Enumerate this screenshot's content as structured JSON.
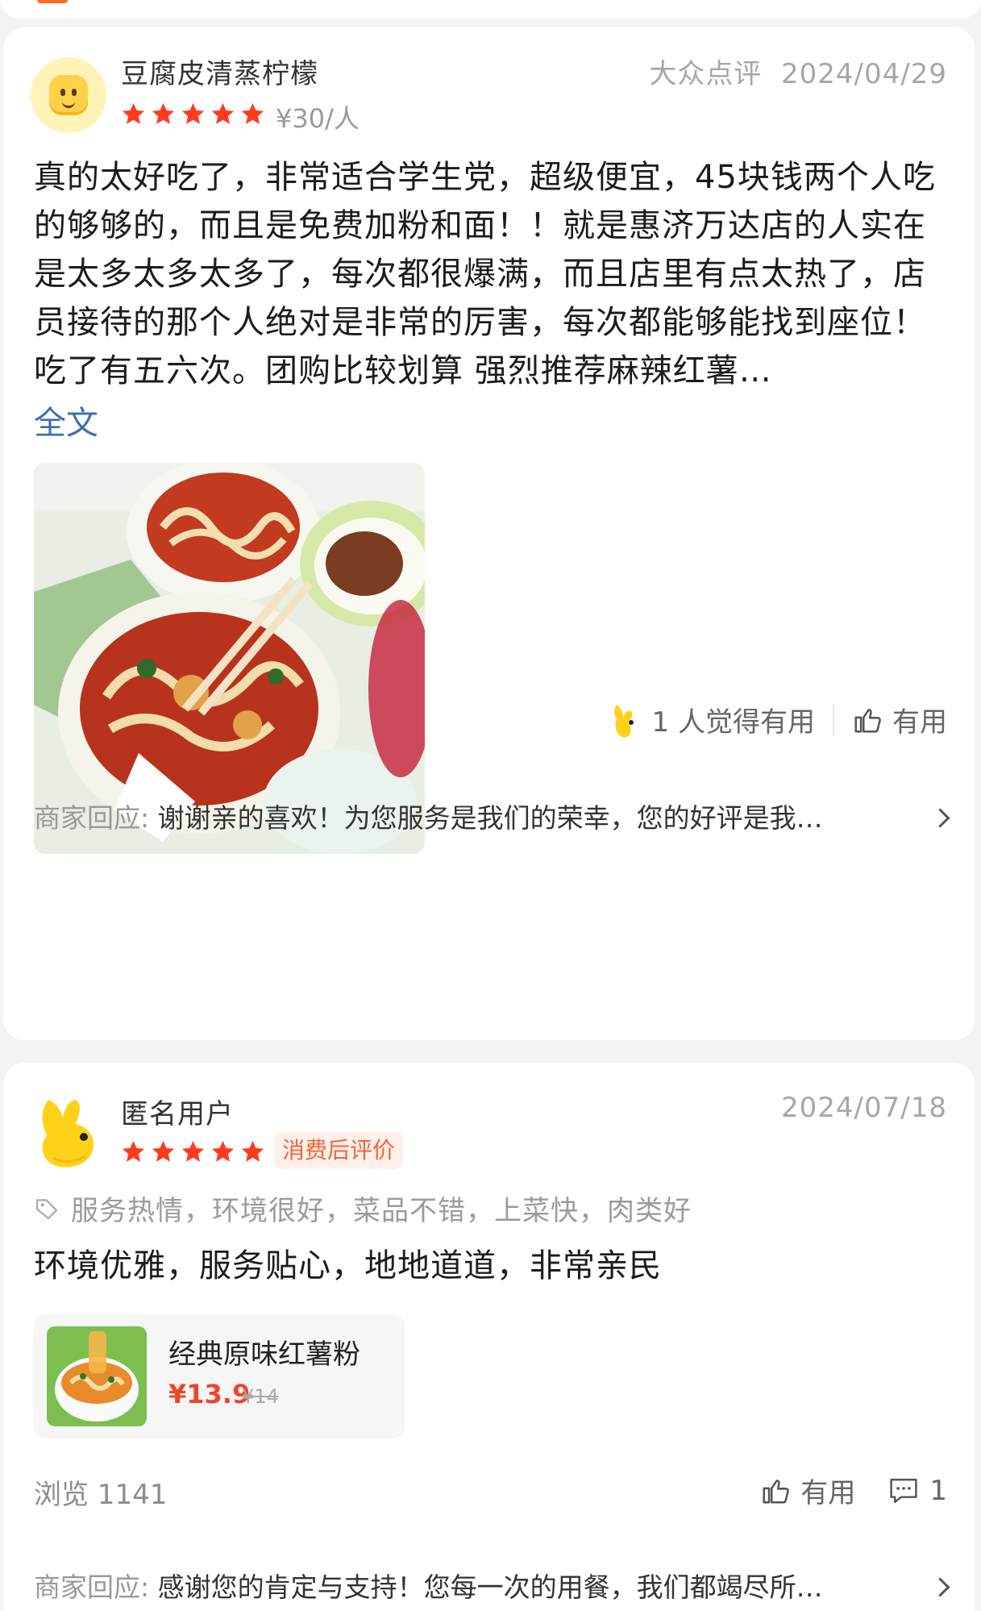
{
  "review1": {
    "username": "豆腐皮清蒸柠檬",
    "source": "大众点评",
    "date": "2024/04/29",
    "rating": 5,
    "price": "¥30/人",
    "text": "真的太好吃了，非常适合学生党，超级便宜，45块钱两个人吃的够够的，而且是免费加粉和面！！就是惠济万达店的人实在是太多太多太多了，每次都很爆满，而且店里有点太热了，店员接待的那个人绝对是非常的厉害，每次都能够能找到座位！吃了有五六次。团购比较划算 强烈推荐麻辣红薯…",
    "fulltext_label": "全文",
    "helpful_count_text": "1 人觉得有用",
    "helpful_button": "有用",
    "merchant_label": "商家回应:",
    "merchant_reply": "谢谢亲的喜欢！为您服务是我们的荣幸，您的好评是我…"
  },
  "review2": {
    "username": "匿名用户",
    "date": "2024/07/18",
    "rating": 5,
    "badge": "消费后评价",
    "tags": "服务热情，环境很好，菜品不错，上菜快，肉类好",
    "text": "环境优雅，服务贴心，地地道道，非常亲民",
    "dish": {
      "name": "经典原味红薯粉",
      "price": "¥13.9",
      "original_price": "¥14"
    },
    "views": "浏览 1141",
    "helpful_button": "有用",
    "comment_count": "1",
    "merchant_label": "商家回应:",
    "merchant_reply": "感谢您的肯定与支持！您每一次的用餐，我们都竭尽所…"
  },
  "colors": {
    "star": "#ff3b1f",
    "badge_text": "#f0643a",
    "link": "#3f6fa8",
    "price": "#f0432a"
  }
}
